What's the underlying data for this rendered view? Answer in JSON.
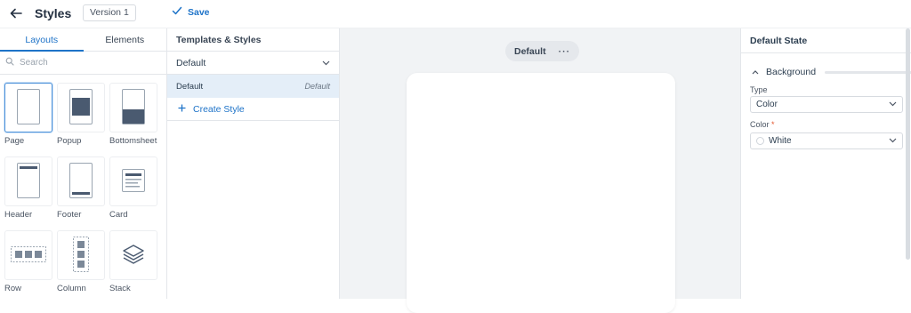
{
  "header": {
    "title": "Styles",
    "version": "Version 1",
    "save_label": "Save"
  },
  "left_panel": {
    "tabs": [
      {
        "label": "Layouts",
        "active": true
      },
      {
        "label": "Elements",
        "active": false
      }
    ],
    "search_placeholder": "Search",
    "items": [
      {
        "label": "Page",
        "icon": "page-icon",
        "selected": true
      },
      {
        "label": "Popup",
        "icon": "popup-icon"
      },
      {
        "label": "Bottomsheet",
        "icon": "bottomsheet-icon"
      },
      {
        "label": "Header",
        "icon": "header-icon"
      },
      {
        "label": "Footer",
        "icon": "footer-icon"
      },
      {
        "label": "Card",
        "icon": "card-icon"
      },
      {
        "label": "Row",
        "icon": "row-icon"
      },
      {
        "label": "Column",
        "icon": "column-icon"
      },
      {
        "label": "Stack",
        "icon": "stack-icon"
      }
    ]
  },
  "middle_panel": {
    "header": "Templates & Styles",
    "template_select": "Default",
    "styles": [
      {
        "name": "Default",
        "tag": "Default"
      }
    ],
    "create_label": "Create Style"
  },
  "canvas": {
    "state_label": "Default",
    "menu_glyph": "···"
  },
  "right_panel": {
    "header": "Default State",
    "section": "Background",
    "type_label": "Type",
    "type_value": "Color",
    "color_label": "Color",
    "required_mark": "*",
    "color_value": "White"
  },
  "colors": {
    "accent": "#1e73c8",
    "selected_row": "#e4eef8",
    "canvas_bg": "#f1f3f5",
    "icon_fill": "#4a5a70"
  }
}
